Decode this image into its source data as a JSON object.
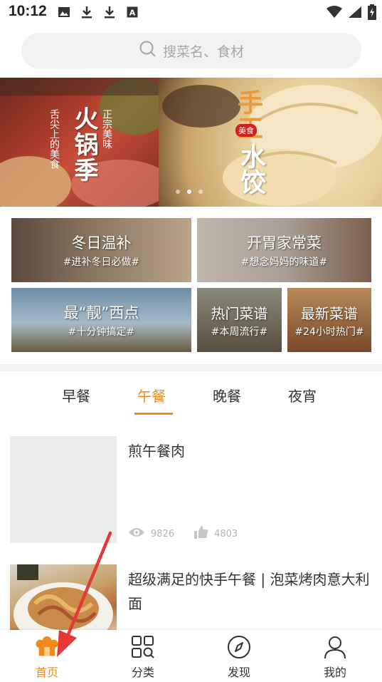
{
  "status_bar": {
    "time": "10:12",
    "left_icons": [
      "image-icon",
      "download-icon",
      "download-icon",
      "font-icon"
    ],
    "right_icons": [
      "wifi-icon",
      "signal-icon",
      "battery-charging-icon"
    ]
  },
  "search": {
    "placeholder": "搜菜名、食材"
  },
  "banner": {
    "left": {
      "title": "火锅季",
      "subtitle_right": "正宗美味",
      "subtitle_left": "舌尖上的美食"
    },
    "right": {
      "title_top": "手工",
      "title_bottom": "水饺",
      "badge": "美食"
    },
    "dots": 3,
    "active_dot": 1
  },
  "categories": [
    {
      "title": "冬日温补",
      "subtitle": "#进补冬日必做#"
    },
    {
      "title": "开胃家常菜",
      "subtitle": "#想念妈妈的味道#"
    },
    {
      "title": "最“靓”西点",
      "subtitle": "#十分钟搞定#"
    },
    {
      "title": "热门菜谱",
      "subtitle": "#本周流行#"
    },
    {
      "title": "最新菜谱",
      "subtitle": "#24小时热门#"
    }
  ],
  "meal_tabs": [
    {
      "label": "早餐",
      "active": false
    },
    {
      "label": "午餐",
      "active": true
    },
    {
      "label": "晚餐",
      "active": false
    },
    {
      "label": "夜宵",
      "active": false
    }
  ],
  "recipes": [
    {
      "title": "煎午餐肉",
      "views": "9826",
      "likes": "4803"
    },
    {
      "title": "超级满足的快手午餐 | 泡菜烤肉意大利面"
    }
  ],
  "bottom_nav": [
    {
      "label": "首页",
      "icon": "home-chef-hat-icon",
      "active": true
    },
    {
      "label": "分类",
      "icon": "category-grid-icon",
      "active": false
    },
    {
      "label": "发现",
      "icon": "compass-icon",
      "active": false
    },
    {
      "label": "我的",
      "icon": "user-icon",
      "active": false
    }
  ],
  "colors": {
    "accent": "#f08a1c",
    "annotation_arrow": "#e53935"
  }
}
